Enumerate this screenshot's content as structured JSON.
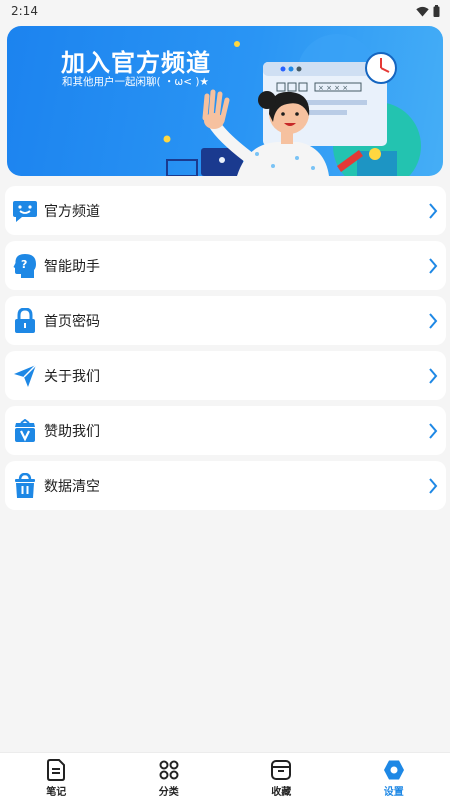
{
  "status_bar": {
    "time": "2:14"
  },
  "banner": {
    "title": "加入官方频道",
    "subtitle": "和其他用户一起闲聊( ・ω< )★",
    "window_text": "× × × ×"
  },
  "menu": [
    {
      "label": "官方频道",
      "icon": "chat-bubble-icon"
    },
    {
      "label": "智能助手",
      "icon": "assistant-head-icon"
    },
    {
      "label": "首页密码",
      "icon": "lock-icon"
    },
    {
      "label": "关于我们",
      "icon": "paper-plane-icon"
    },
    {
      "label": "赞助我们",
      "icon": "sponsor-bag-icon"
    },
    {
      "label": "数据清空",
      "icon": "trash-bag-icon"
    }
  ],
  "tabs": [
    {
      "label": "笔记",
      "icon": "note-icon",
      "active": false
    },
    {
      "label": "分类",
      "icon": "category-icon",
      "active": false
    },
    {
      "label": "收藏",
      "icon": "favorite-box-icon",
      "active": false
    },
    {
      "label": "设置",
      "icon": "settings-icon",
      "active": true
    }
  ],
  "colors": {
    "accent": "#1e88e5",
    "background": "#f5f5f5",
    "card": "#ffffff"
  }
}
